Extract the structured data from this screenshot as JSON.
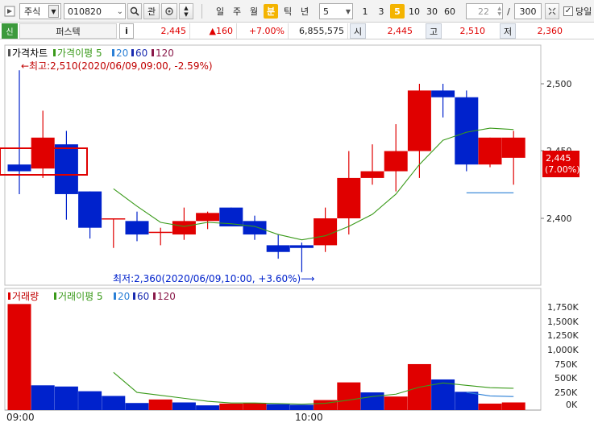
{
  "toolbar": {
    "market_select": "주식",
    "code_input": "010820",
    "btn_search": "",
    "btn_related": "관",
    "periods": [
      "일",
      "주",
      "월",
      "분",
      "틱",
      "년"
    ],
    "active_period": "분",
    "interval_value": "5",
    "minute_options": [
      "1",
      "3",
      "5",
      "10",
      "30",
      "60"
    ],
    "active_minute": "5",
    "count_value": "22",
    "count_total": "300",
    "today_checkbox_label": "당일"
  },
  "infobar": {
    "credit_badge": "신",
    "stock_name": "퍼스텍",
    "info_button": "i",
    "price": "2,445",
    "change": "▲160",
    "change_rate": "+7.00%",
    "volume": "6,855,575",
    "open_label": "시",
    "open_value": "2,445",
    "high_label": "고",
    "high_value": "2,510",
    "low_label": "저",
    "low_value": "2,360"
  },
  "price_panel": {
    "legend": {
      "title": "가격차트",
      "ma_label": "가격이평 5",
      "ma20": "20",
      "ma60": "60",
      "ma120": "120"
    },
    "annotations": {
      "high": "←최고:2,510(2020/06/09,09:00, -2.59%)",
      "low": "최저:2,360(2020/06/09,10:00, +3.60%)⟶"
    },
    "current_price_tag": "2,445",
    "current_rate_tag": "(7.00%)",
    "y_ticks": [
      "2,500",
      "2,450",
      "2,400"
    ]
  },
  "volume_panel": {
    "legend": {
      "title": "거래량",
      "ma_label": "거래이평 5",
      "ma20": "20",
      "ma60": "60",
      "ma120": "120"
    },
    "y_ticks": [
      "1,750K",
      "1,500K",
      "1,250K",
      "1,000K",
      "750K",
      "500K",
      "250K",
      "0K"
    ]
  },
  "x_axis": {
    "labels": [
      "09:00",
      "10:00"
    ]
  },
  "colors": {
    "up": "#e00000",
    "down": "#0022cc",
    "ma5": "#3a9a1a",
    "ma20": "#2a7fd6"
  },
  "chart_data": [
    {
      "type": "candlestick",
      "title": "가격차트",
      "ylim": [
        2340,
        2520
      ],
      "candles": [
        {
          "o": 2440,
          "h": 2510,
          "l": 2418,
          "c": 2435
        },
        {
          "o": 2437,
          "h": 2480,
          "l": 2430,
          "c": 2460
        },
        {
          "o": 2455,
          "h": 2465,
          "l": 2399,
          "c": 2418
        },
        {
          "o": 2420,
          "h": 2420,
          "l": 2385,
          "c": 2393
        },
        {
          "o": 2400,
          "h": 2400,
          "l": 2378,
          "c": 2400
        },
        {
          "o": 2398,
          "h": 2405,
          "l": 2383,
          "c": 2388
        },
        {
          "o": 2390,
          "h": 2393,
          "l": 2380,
          "c": 2390
        },
        {
          "o": 2388,
          "h": 2408,
          "l": 2384,
          "c": 2398
        },
        {
          "o": 2398,
          "h": 2405,
          "l": 2392,
          "c": 2404
        },
        {
          "o": 2408,
          "h": 2408,
          "l": 2394,
          "c": 2394
        },
        {
          "o": 2398,
          "h": 2402,
          "l": 2384,
          "c": 2388
        },
        {
          "o": 2380,
          "h": 2388,
          "l": 2370,
          "c": 2375
        },
        {
          "o": 2380,
          "h": 2382,
          "l": 2360,
          "c": 2378
        },
        {
          "o": 2380,
          "h": 2408,
          "l": 2375,
          "c": 2400
        },
        {
          "o": 2400,
          "h": 2450,
          "l": 2388,
          "c": 2430
        },
        {
          "o": 2430,
          "h": 2455,
          "l": 2425,
          "c": 2435
        },
        {
          "o": 2435,
          "h": 2470,
          "l": 2420,
          "c": 2450
        },
        {
          "o": 2450,
          "h": 2500,
          "l": 2430,
          "c": 2495
        },
        {
          "o": 2495,
          "h": 2500,
          "l": 2475,
          "c": 2490
        },
        {
          "o": 2490,
          "h": 2495,
          "l": 2435,
          "c": 2440
        },
        {
          "o": 2440,
          "h": 2460,
          "l": 2438,
          "c": 2460
        },
        {
          "o": 2445,
          "h": 2465,
          "l": 2425,
          "c": 2460
        }
      ],
      "ma5": [
        null,
        null,
        null,
        null,
        2422,
        2409,
        2397,
        2394,
        2397,
        2396,
        2394,
        2388,
        2384,
        2387,
        2394,
        2403,
        2418,
        2440,
        2458,
        2464,
        2467,
        2466
      ],
      "ma20": [
        null,
        null,
        null,
        null,
        null,
        null,
        null,
        null,
        null,
        null,
        null,
        null,
        null,
        null,
        null,
        null,
        null,
        null,
        null,
        2419,
        2419,
        2419
      ]
    },
    {
      "type": "bar",
      "title": "거래량",
      "ylim": [
        0,
        1800000
      ],
      "values": [
        1800000,
        420000,
        400000,
        320000,
        240000,
        120000,
        180000,
        130000,
        80000,
        110000,
        120000,
        100000,
        90000,
        170000,
        470000,
        300000,
        230000,
        780000,
        520000,
        310000,
        110000,
        130000
      ],
      "directions": [
        "up",
        "down",
        "down",
        "down",
        "down",
        "down",
        "up",
        "down",
        "down",
        "up",
        "up",
        "down",
        "down",
        "up",
        "up",
        "down",
        "up",
        "up",
        "down",
        "down",
        "up",
        "up"
      ],
      "ma5": [
        null,
        null,
        null,
        null,
        640000,
        300000,
        250000,
        200000,
        150000,
        120000,
        120000,
        110000,
        100000,
        115000,
        170000,
        230000,
        270000,
        390000,
        460000,
        420000,
        380000,
        370000
      ],
      "ma20": [
        null,
        null,
        null,
        null,
        null,
        null,
        null,
        null,
        null,
        null,
        null,
        null,
        null,
        null,
        null,
        null,
        null,
        null,
        null,
        300000,
        240000,
        230000
      ]
    }
  ]
}
